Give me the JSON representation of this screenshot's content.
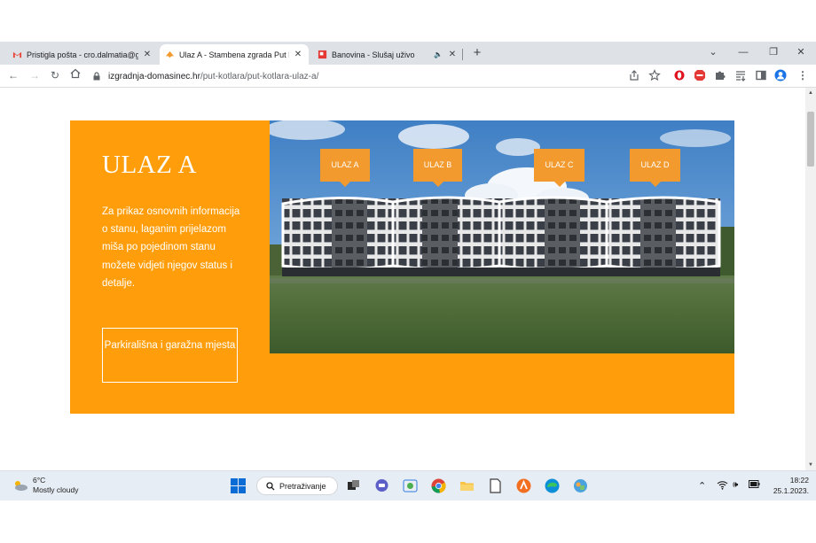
{
  "browser": {
    "tabs": [
      {
        "title": "Pristigla pošta - cro.dalmatia@gm",
        "favicon": "gmail-icon",
        "active": false
      },
      {
        "title": "Ulaz A - Stambena zgrada Put Kotlara",
        "favicon": "site-icon",
        "active": true
      },
      {
        "title": "Banovina - Slušaj uživo",
        "favicon": "radio-icon",
        "active": false,
        "audio": true
      }
    ],
    "new_tab_label": "+",
    "window_controls": {
      "dropdown": "⌄",
      "minimize": "—",
      "restore": "❐",
      "close": "✕"
    },
    "url": {
      "host": "izgradnja-domasinec.hr",
      "path": "/put-kotlara/put-kotlara-ulaz-a/"
    }
  },
  "page": {
    "title": "ULAZ A",
    "intro": "Za prikaz osnovnih informacija o stanu, laganim prijelazom miša po pojedinom stanu možete vidjeti njegov status i detalje.",
    "parking_button": "Parkirališna i garažna mjesta",
    "entries": [
      "ULAZ A",
      "ULAZ B",
      "ULAZ C",
      "ULAZ D"
    ],
    "colors": {
      "panel": "#ff9e0a",
      "tag": "#f29a2e",
      "text": "#ffffff"
    }
  },
  "taskbar": {
    "weather_temp": "6°C",
    "weather_desc": "Mostly cloudy",
    "search_label": "Pretraživanje",
    "time": "18:22",
    "date": "25.1.2023."
  }
}
